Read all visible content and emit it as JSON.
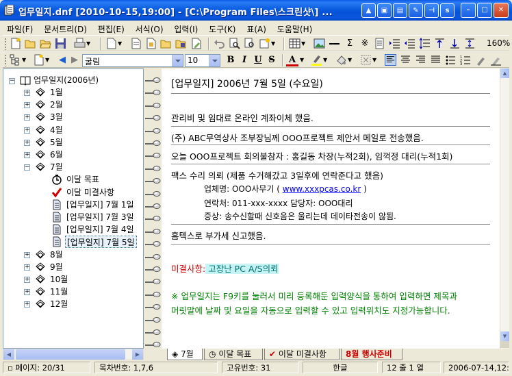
{
  "window": {
    "title": "업무일지.dnf  [2010-10-15,19:00] - [C:\\Program Files\\스크린샷\\] ...",
    "controls": [
      "minimize",
      "maximize",
      "close"
    ],
    "extra_btn_label": "s"
  },
  "menu": [
    "파일(F)",
    "문서트리(D)",
    "편집(E)",
    "서식(O)",
    "입력(I)",
    "도구(K)",
    "표(A)",
    "도움말(H)"
  ],
  "toolbar2": {
    "font_name": "굴림",
    "font_size": "10",
    "bold": "B",
    "italic": "I",
    "underline": "U",
    "strike": "S",
    "font_color": "A"
  },
  "toolbar1": {
    "zoom": "160%"
  },
  "tree": {
    "root": "업무일지(2006년)",
    "months": [
      "1월",
      "2월",
      "3월",
      "4월",
      "5월",
      "6월",
      "7월",
      "8월",
      "9월",
      "10월",
      "11월",
      "12월"
    ],
    "july_children": [
      {
        "label": "이달 목표",
        "icon": "clock-icon"
      },
      {
        "label": "이달 미결사항",
        "icon": "checkmark-icon"
      },
      {
        "label": "[업무일지] 7월 1일",
        "icon": "document-icon"
      },
      {
        "label": "[업무일지] 7월 3일",
        "icon": "document-icon"
      },
      {
        "label": "[업무일지] 7월 4일",
        "icon": "document-icon"
      },
      {
        "label": "[업무일지] 7월 5일",
        "icon": "document-icon",
        "selected": true
      }
    ]
  },
  "doc": {
    "heading": "[업무일지] 2006년 7월 5일 (수요일)",
    "line1": "관리비 및 임대료 온라인 계좌이체 했음.",
    "line2": "(주) ABC무역상사 조부장님께 OOO프로젝트 제안서 메일로 전송했음.",
    "line3": "오늘 OOO프로젝트 회의불참자 : 홍길동 차장(누적2회), 임꺽정 대리(누적1회)",
    "line4": "팩스 수리 의뢰 (제품 수거해갔고 3일후에 연락준다고 했음)",
    "vendor_label": "업체명:  OOO사무기  ( ",
    "vendor_link": "www.xxxpcas.co.kr",
    "vendor_close": " )",
    "contact": "연락처: 011-xxx-xxxx    담당자: OOO대리",
    "symptom": "증상: 송수신할때 신호음은 울리는데 데이타전송이 않됨.",
    "line5": "홈텍스로  부가세 신고했음.",
    "pending_label": "미결사항:",
    "pending_value": " 고장난 PC A/S의뢰",
    "note1": "※ 업무일지는 F9키를 눌러서 미리 등록해둔 입력양식을 통하여 입력하면 제목과",
    "note2": "머릿말에 날짜 및 요일을 자동으로 입력할 수 있고 입력위치도 지정가능합니다."
  },
  "tabs": [
    {
      "label": "7월",
      "icon": "tag-icon"
    },
    {
      "label": "이달 목표",
      "icon": "clock-icon"
    },
    {
      "label": "이달 미결사항",
      "icon": "checkmark-icon"
    },
    {
      "label": "8월 행사준비",
      "icon": ""
    }
  ],
  "status": {
    "page": "페이지: 20/31",
    "toc": "목차번호: 1,7,6",
    "uid": "고유번호: 31",
    "ime": "한글",
    "pos": "12 줄  1 열",
    "datetime": "2006-07-14,12:50"
  },
  "colors": {
    "red": "#cc0000",
    "green": "#008000",
    "highlight": "#c6f4f4",
    "link": "#0000ee"
  }
}
